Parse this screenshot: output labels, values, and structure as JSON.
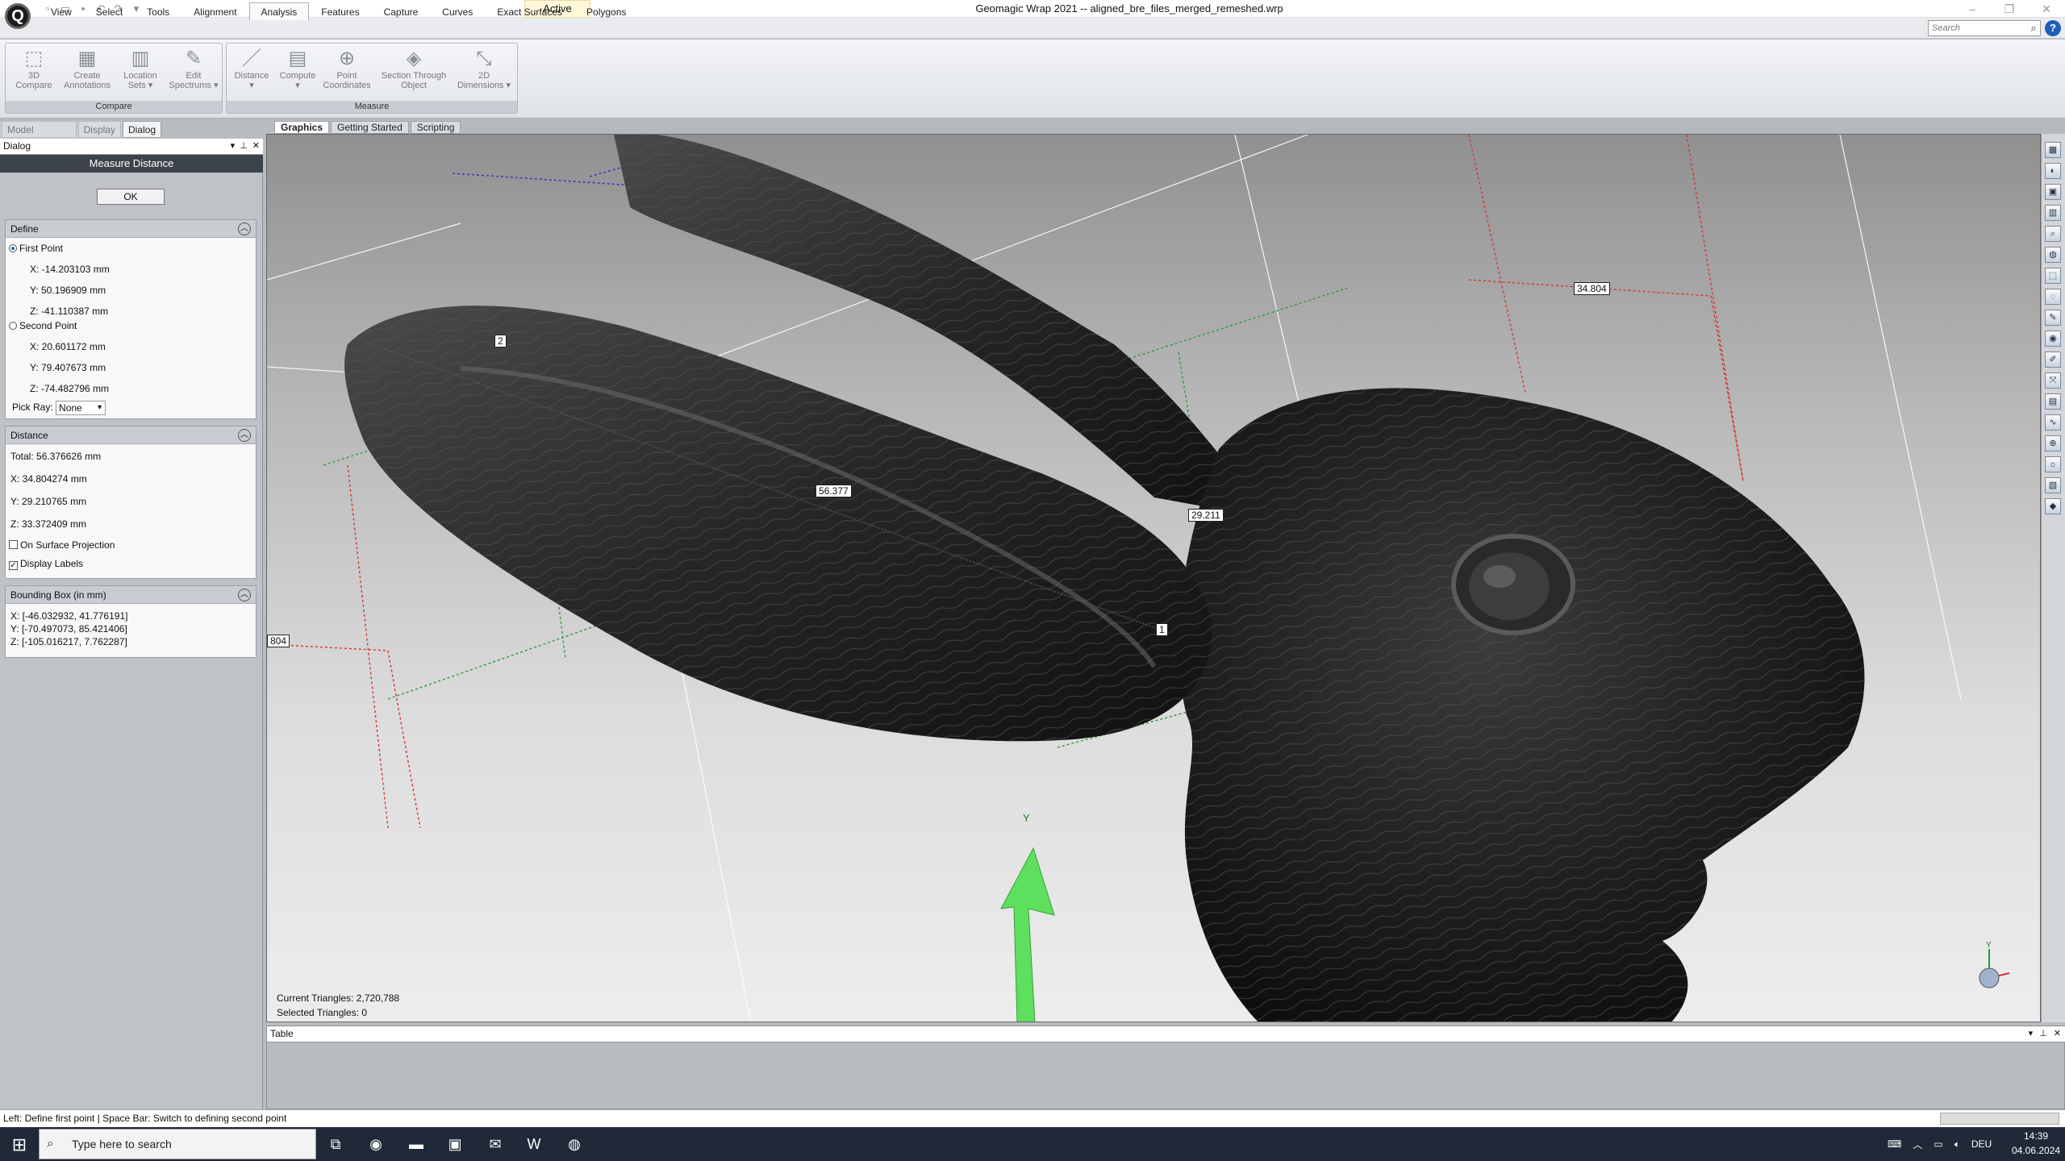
{
  "app": {
    "logo_letter": "Q",
    "title": "Geomagic Wrap 2021 -- aligned_bre_files_merged_remeshed.wrp",
    "active_state": "Active"
  },
  "qat": [
    {
      "name": "new-file-icon",
      "glyph": "▫"
    },
    {
      "name": "open-file-icon",
      "glyph": "▭"
    },
    {
      "name": "save-icon",
      "glyph": "▪"
    },
    {
      "name": "undo-icon",
      "glyph": "↶"
    },
    {
      "name": "redo-icon",
      "glyph": "↷"
    },
    {
      "name": "qat-dropdown-icon",
      "glyph": "▾"
    }
  ],
  "window_controls": [
    "–",
    "❐",
    "✕"
  ],
  "menu": [
    "View",
    "Select",
    "Tools",
    "Alignment",
    "Analysis",
    "Features",
    "Capture",
    "Curves",
    "Exact Surfaces",
    "Polygons"
  ],
  "menu_active": "Analysis",
  "search_placeholder": "Search",
  "ribbon": {
    "compare": {
      "label": "Compare",
      "buttons": [
        {
          "line1": "3D",
          "line2": "Compare",
          "glyph": "⬚"
        },
        {
          "line1": "Create",
          "line2": "Annotations",
          "glyph": "▦"
        },
        {
          "line1": "Location",
          "line2": "Sets ▾",
          "glyph": "▥"
        },
        {
          "line1": "Edit",
          "line2": "Spectrums ▾",
          "glyph": "✎"
        }
      ]
    },
    "measure": {
      "label": "Measure",
      "buttons": [
        {
          "line1": "Distance",
          "line2": "▾",
          "glyph": "／"
        },
        {
          "line1": "Compute",
          "line2": "▾",
          "glyph": "▤"
        },
        {
          "line1": "Point",
          "line2": "Coordinates",
          "glyph": "⊕"
        },
        {
          "line1": "Section Through",
          "line2": "Object",
          "glyph": "◈"
        },
        {
          "line1": "2D",
          "line2": "Dimensions ▾",
          "glyph": "⤡"
        }
      ]
    }
  },
  "panel_tabs": [
    "Model Manager",
    "Display",
    "Dialog"
  ],
  "panel_tab_active": "Dialog",
  "dialog": {
    "header": "Dialog",
    "title": "Measure Distance",
    "ok_label": "OK",
    "define": {
      "title": "Define",
      "first_point_label": "First Point",
      "first": [
        "X: -14.203103 mm",
        "Y: 50.196909 mm",
        "Z: -41.110387 mm"
      ],
      "second_point_label": "Second Point",
      "second": [
        "X: 20.601172 mm",
        "Y: 79.407673 mm",
        "Z: -74.482796 mm"
      ],
      "pick_ray_label": "Pick Ray:",
      "pick_ray_value": "None"
    },
    "distance": {
      "title": "Distance",
      "total": "Total: 56.376626 mm",
      "x": "X: 34.804274 mm",
      "y": "Y: 29.210765 mm",
      "z": "Z: 33.372409 mm",
      "on_surface_label": "On Surface Projection",
      "on_surface_checked": false,
      "display_labels_label": "Display Labels",
      "display_labels_checked": true
    },
    "bbox": {
      "title": "Bounding Box (in mm)",
      "x": "X: [-46.032932, 41.776191]",
      "y": "Y: [-70.497073, 85.421406]",
      "z": "Z: [-105.016217, 7.762287]"
    }
  },
  "view_tabs": [
    "Graphics",
    "Getting Started",
    "Scripting"
  ],
  "view_tab_active": "Graphics",
  "viewport": {
    "labels": {
      "total": "56.377",
      "y": "29.211",
      "x": "34.804",
      "point1": "1",
      "point2": "2",
      "edge": "804"
    },
    "axis_label": "Y",
    "current_triangles": "Current Triangles: 2,720,788",
    "selected_triangles": "Selected Triangles: 0"
  },
  "table": {
    "title": "Table"
  },
  "status_text": "Left: Define first point | Space Bar: Switch to defining second point",
  "taskbar": {
    "search_placeholder": "Type here to search",
    "apps": [
      {
        "name": "task-view-icon",
        "glyph": "⧉"
      },
      {
        "name": "edge-icon",
        "glyph": "◉"
      },
      {
        "name": "file-explorer-icon",
        "glyph": "▬"
      },
      {
        "name": "store-icon",
        "glyph": "▣"
      },
      {
        "name": "mail-icon",
        "glyph": "✉"
      },
      {
        "name": "wps-office-icon",
        "glyph": "W"
      },
      {
        "name": "chrome-icon",
        "glyph": "◍"
      }
    ],
    "language": "DEU",
    "time": "14:39",
    "date": "04.06.2024"
  },
  "colors": {
    "axis_red": "#d93030",
    "axis_green": "#2a9a3a",
    "axis_blue": "#3030c0",
    "arrow_green": "#5ee05e",
    "active_tab_bg": "#fff7d9"
  }
}
